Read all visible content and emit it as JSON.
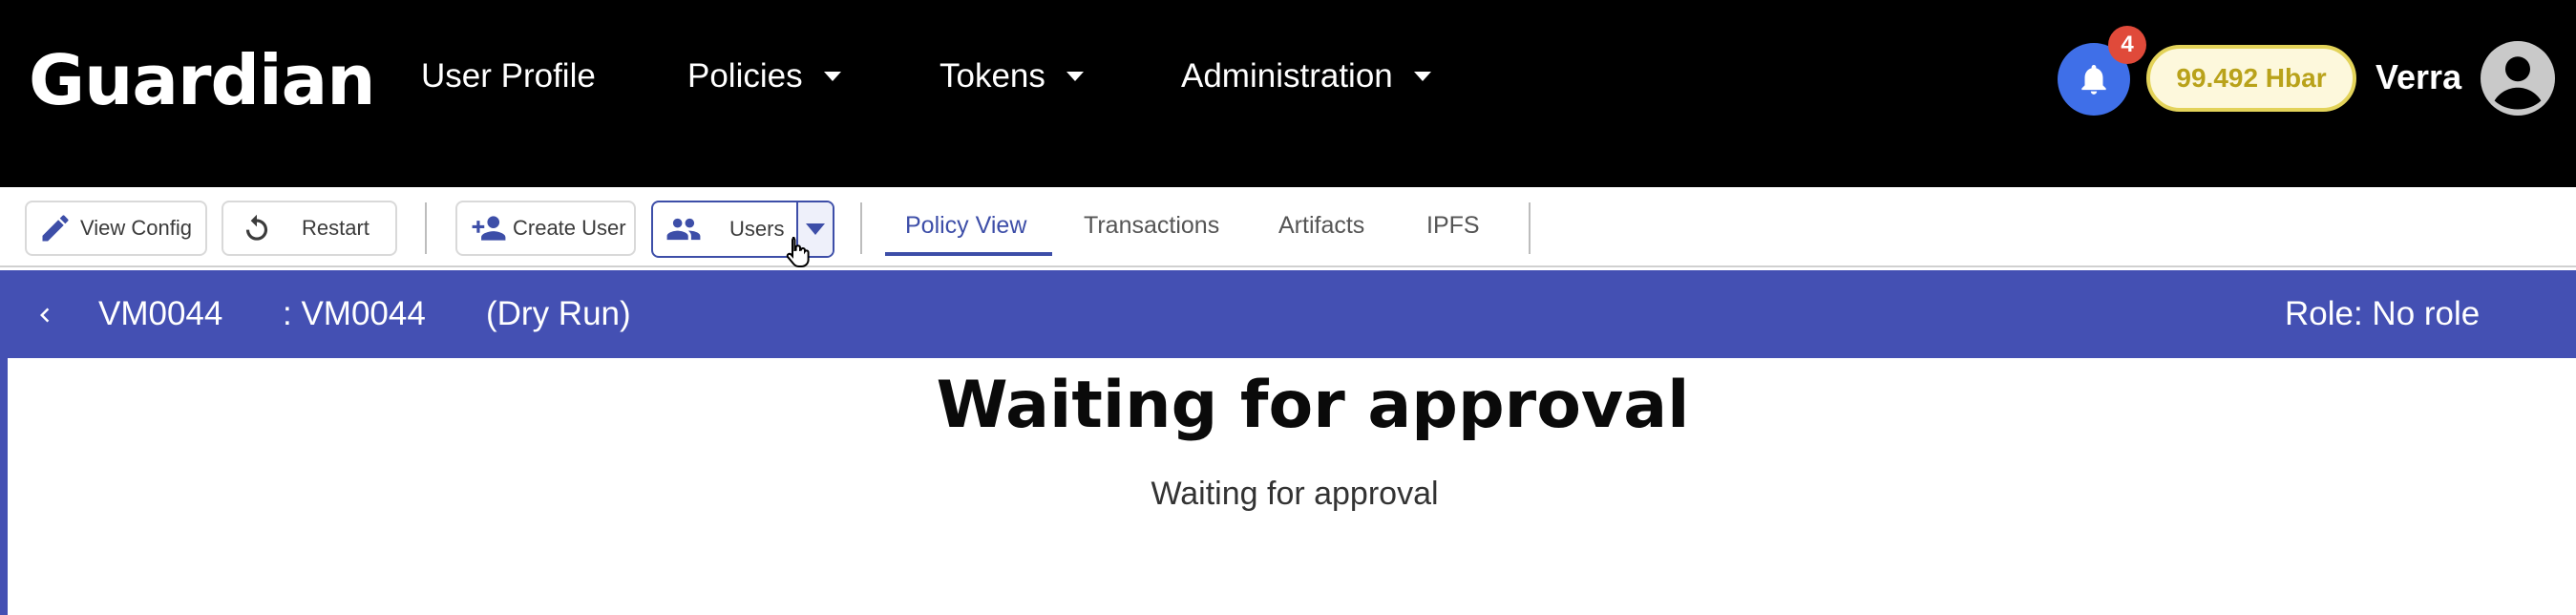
{
  "app": {
    "brand": "Guardian"
  },
  "nav": {
    "items": [
      {
        "label": "User Profile",
        "has_dropdown": false
      },
      {
        "label": "Policies",
        "has_dropdown": true
      },
      {
        "label": "Tokens",
        "has_dropdown": true
      },
      {
        "label": "Administration",
        "has_dropdown": true
      }
    ],
    "notifications_count": "4",
    "balance": "99.492 Hbar",
    "username": "Verra"
  },
  "toolbar": {
    "view_config": "View Config",
    "restart": "Restart",
    "create_user": "Create User",
    "users": "Users",
    "tabs": [
      {
        "label": "Policy View",
        "active": true
      },
      {
        "label": "Transactions",
        "active": false
      },
      {
        "label": "Artifacts",
        "active": false
      },
      {
        "label": "IPFS",
        "active": false
      }
    ]
  },
  "policy_bar": {
    "policy_name": "VM0044",
    "policy_id": ": VM0044",
    "mode": "(Dry Run)",
    "role": "Role: No role"
  },
  "content": {
    "title": "Waiting for approval",
    "subtitle": "Waiting for approval"
  },
  "colors": {
    "navbar_bg": "#000000",
    "accent": "#4450b3",
    "notification_bg": "#3f6fe8",
    "badge_bg": "#e04a3a",
    "balance_text": "#b9a21a"
  }
}
